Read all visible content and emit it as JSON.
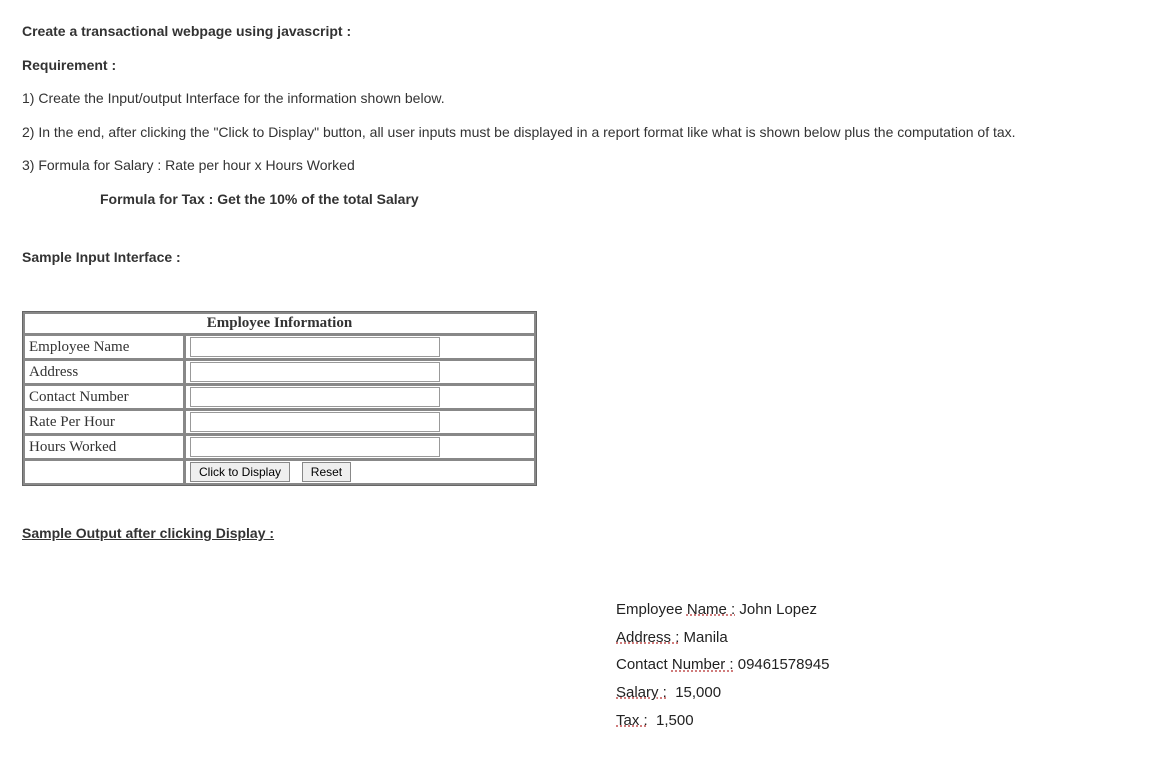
{
  "heading": "Create a transactional webpage using javascript :",
  "requirement_label": "Requirement :",
  "req1": "1) Create the Input/output Interface for the information shown below.",
  "req2": "2) In the end, after clicking the \"Click to Display\" button, all user inputs must be displayed in a report format like what is shown below plus the computation of tax.",
  "req3": "3) Formula for Salary : Rate per hour x Hours Worked",
  "formula_tax": "Formula for Tax : Get the 10% of the total Salary",
  "sample_input_label": "Sample Input Interface :",
  "table": {
    "header": "Employee Information",
    "rows": {
      "name": "Employee Name",
      "address": "Address",
      "contact": "Contact Number",
      "rate": "Rate Per Hour",
      "hours": "Hours Worked"
    },
    "buttons": {
      "display": "Click to Display",
      "reset": "Reset"
    }
  },
  "sample_output_label": "Sample Output after clicking Display :",
  "output": {
    "name_label": "Employee",
    "name_label2": "Name :",
    "name_value": "John Lopez",
    "address_label": "Address :",
    "address_value": "Manila",
    "contact_label_a": "Contact",
    "contact_label_b": "Number :",
    "contact_value": "09461578945",
    "salary_label": "Salary :",
    "salary_value": "15,000",
    "tax_label": "Tax :",
    "tax_value": "1,500"
  }
}
